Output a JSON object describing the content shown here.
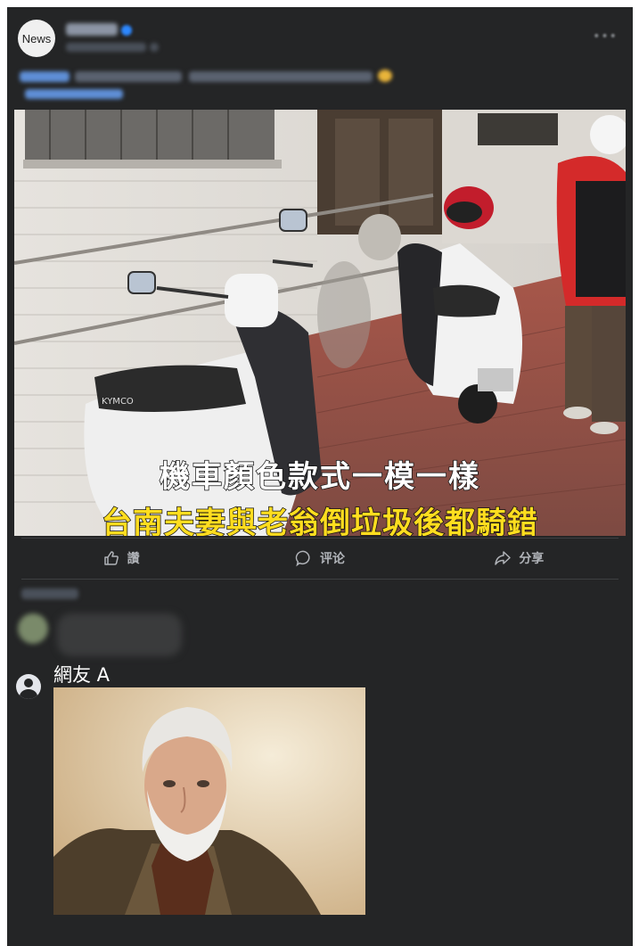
{
  "post": {
    "page_avatar_text": "News",
    "image_caption_line1": "機車顏色款式一模一樣",
    "image_caption_line2": "台南夫妻與老翁倒垃圾後都騎錯"
  },
  "actions": {
    "like_label": "讚",
    "comment_label": "评论",
    "share_label": "分享"
  },
  "comment": {
    "commenter_name": "網友 A"
  },
  "colors": {
    "card_background": "#242526",
    "caption_white": "#ffffff",
    "caption_yellow": "#ffdd1f",
    "muted_text": "#b0b3b8"
  },
  "icons": {
    "like": "thumbs-up-icon",
    "comment": "speech-bubble-icon",
    "share": "share-arrow-icon",
    "user": "user-silhouette-icon",
    "more": "more-options-icon"
  }
}
